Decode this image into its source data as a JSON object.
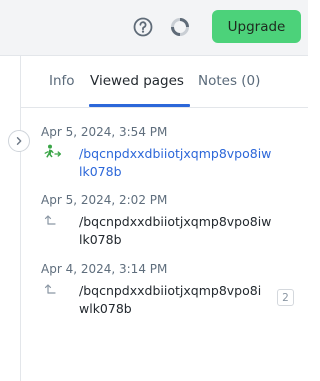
{
  "header": {
    "help_icon": "question-circle-icon",
    "loader_icon": "loading-spinner-icon",
    "upgrade_label": "Upgrade",
    "upgrade_color": "#4cd27a"
  },
  "tabs": [
    {
      "label": "Info",
      "active": false
    },
    {
      "label": "Viewed pages",
      "active": true
    },
    {
      "label": "Notes (0)",
      "active": false
    }
  ],
  "accent_color": "#2c67d9",
  "viewed_pages": [
    {
      "timestamp": "Apr 5, 2024, 3:54 PM",
      "url": "/bqcnpdxxdbiiotjxqmp8vpo8iwlk078b",
      "icon": "person-arriving-icon",
      "current": true
    },
    {
      "timestamp": "Apr 5, 2024, 2:02 PM",
      "url": "/bqcnpdxxdbiiotjxqmp8vpo8iwlk078b",
      "icon": "arrow-up-left-icon",
      "current": false
    },
    {
      "timestamp": "Apr 4, 2024, 3:14 PM",
      "url": "/bqcnpdxxdbiiotjxqmp8vpo8iwlk078b",
      "icon": "arrow-up-left-icon",
      "current": false,
      "count": "2"
    }
  ]
}
